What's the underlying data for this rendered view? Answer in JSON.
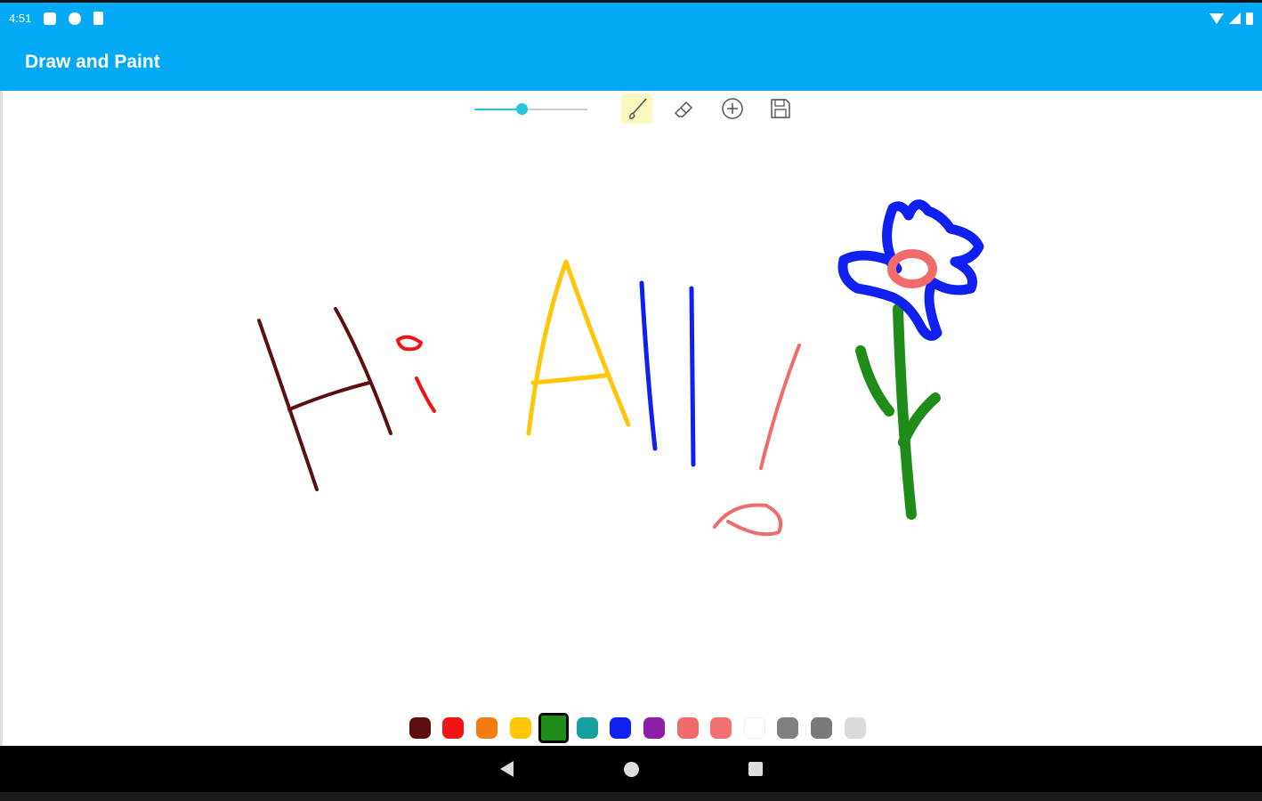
{
  "status_bar": {
    "time": "4:51",
    "left_icons": [
      "notification-icon",
      "app-f-icon",
      "sd-card-icon"
    ],
    "right_icons": [
      "wifi-icon",
      "signal-icon",
      "battery-icon"
    ]
  },
  "app_bar": {
    "title": "Draw and Paint"
  },
  "toolbar": {
    "brush_size_fraction": 0.42,
    "tools": [
      {
        "name": "brush",
        "icon": "brush-icon",
        "active": true
      },
      {
        "name": "eraser",
        "icon": "eraser-icon",
        "active": false
      },
      {
        "name": "new",
        "icon": "add-circle-icon",
        "active": false
      },
      {
        "name": "save",
        "icon": "save-icon",
        "active": false
      }
    ]
  },
  "palette": {
    "colors": [
      "#5D0E0E",
      "#F21414",
      "#F57C12",
      "#FFC60A",
      "#1F8C1A",
      "#17A0A0",
      "#1020F0",
      "#8E1EAA",
      "#F26B6B",
      "#F27070",
      "#FFFFFF",
      "#808080",
      "#7A7A7A",
      "#DADADA"
    ],
    "selected_index": 4
  },
  "drawing_colors": {
    "hi_h": "#5D0E0E",
    "hi_i": "#F21414",
    "letter_a": "#FFC60A",
    "letters_l": "#1020F0",
    "exclamation": "#F26B6B",
    "petals": "#1020F0",
    "flower_center": "#F26B6B",
    "stem": "#1F8C1A"
  },
  "nav_bar": {
    "buttons": [
      "back-icon",
      "home-icon",
      "recents-icon"
    ]
  }
}
